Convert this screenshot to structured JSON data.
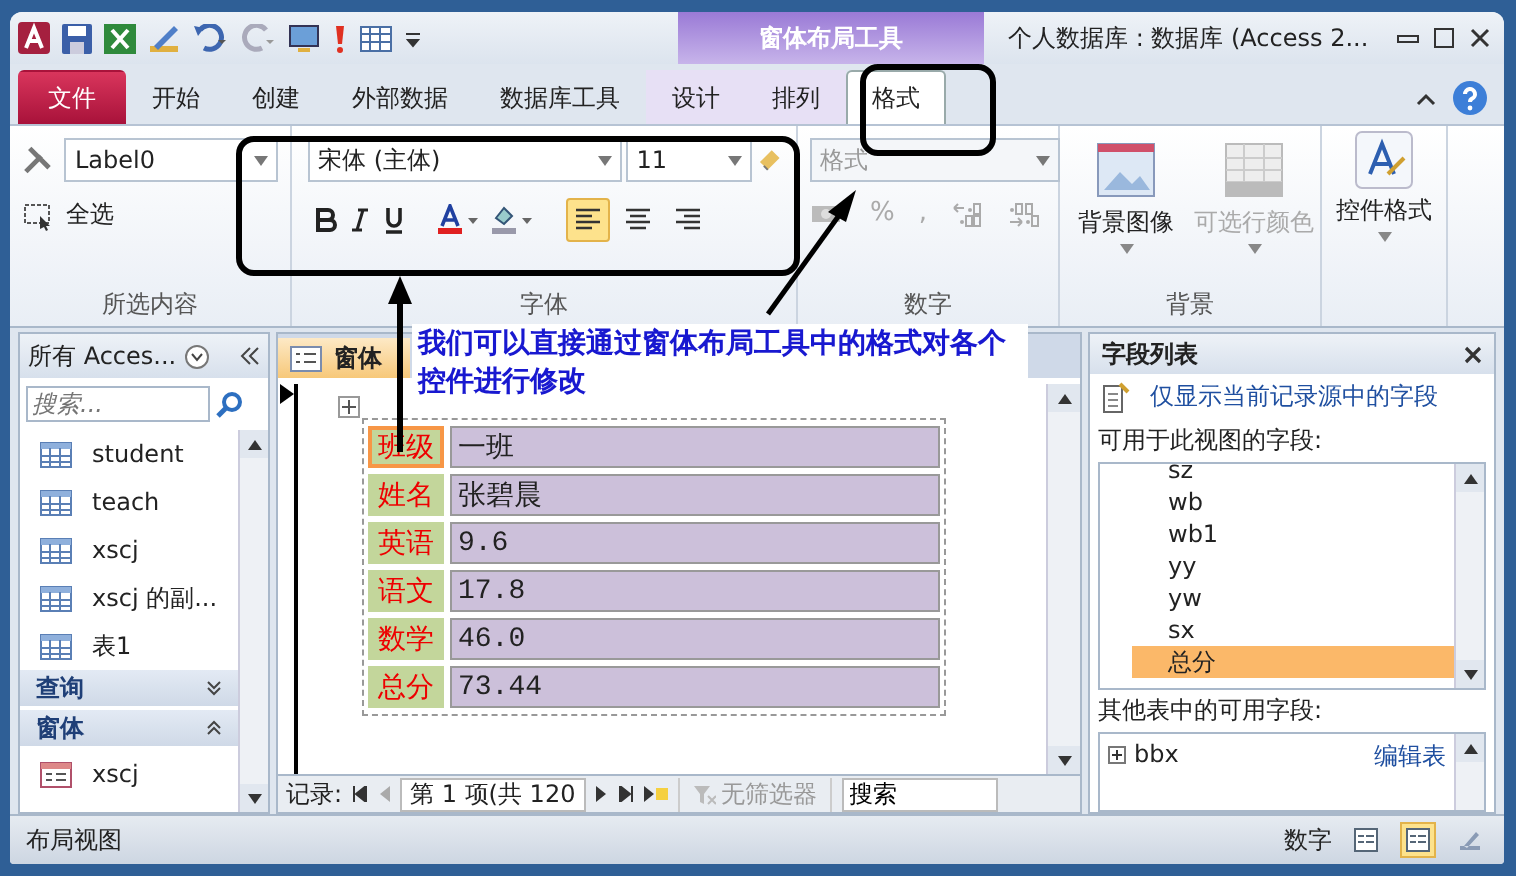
{
  "window": {
    "title": "个人数据库 : 数据库 (Access 2...",
    "contextual_group": "窗体布局工具"
  },
  "tabs": [
    {
      "label": "文件",
      "kind": "file",
      "selected": false
    },
    {
      "label": "开始",
      "kind": "tab",
      "selected": false
    },
    {
      "label": "创建",
      "kind": "tab",
      "selected": false
    },
    {
      "label": "外部数据",
      "kind": "tab",
      "selected": false
    },
    {
      "label": "数据库工具",
      "kind": "tab",
      "selected": false
    },
    {
      "label": "设计",
      "kind": "context",
      "selected": false
    },
    {
      "label": "排列",
      "kind": "context",
      "selected": false
    },
    {
      "label": "格式",
      "kind": "context",
      "selected": true
    }
  ],
  "selection_group": {
    "caption": "所选内容",
    "object": "Label0",
    "select_all": "全选"
  },
  "font_group": {
    "caption": "字体",
    "font": "宋体 (主体)",
    "size": "11",
    "alignment": [
      {
        "selected": true
      },
      {
        "selected": false
      },
      {
        "selected": false
      }
    ]
  },
  "number_group": {
    "caption": "数字",
    "format_placeholder": "格式",
    "buttons": [
      "%",
      ","
    ]
  },
  "background_group": {
    "caption": "背景",
    "buttons": [
      {
        "label": "背景图像",
        "disabled": false
      },
      {
        "label": "可选行颜色",
        "disabled": true
      }
    ]
  },
  "control_group": {
    "button": "控件格式"
  },
  "navigation": {
    "title": "所有 Acces...",
    "search_placeholder": "搜索...",
    "items": [
      {
        "kind": "table",
        "label": "student"
      },
      {
        "kind": "table",
        "label": "teach"
      },
      {
        "kind": "table",
        "label": "xscj"
      },
      {
        "kind": "table",
        "label": "xscj 的副..."
      },
      {
        "kind": "table",
        "label": "表1"
      },
      {
        "kind": "group",
        "label": "查询",
        "expanded": false
      },
      {
        "kind": "group",
        "label": "窗体",
        "expanded": true
      },
      {
        "kind": "form",
        "label": "xscj"
      }
    ]
  },
  "document": {
    "tab": "窗体",
    "fields": [
      {
        "label": "班级",
        "value": "一班",
        "selected": true
      },
      {
        "label": "姓名",
        "value": "张碧晨",
        "selected": false
      },
      {
        "label": "英语",
        "value": "9.6",
        "selected": false
      },
      {
        "label": "语文",
        "value": "17.8",
        "selected": false
      },
      {
        "label": "数学",
        "value": "46.0",
        "selected": false
      },
      {
        "label": "总分",
        "value": "73.44",
        "selected": false
      }
    ],
    "record_nav": {
      "label": "记录:",
      "position": "第 1 项(共 120",
      "filter": "无筛选器",
      "search": "搜索"
    }
  },
  "annotation": {
    "text": "我们可以直接通过窗体布局工具中的格式对各个控件进行修改"
  },
  "field_list": {
    "title": "字段列表",
    "link": "仅显示当前记录源中的字段",
    "available_label": "可用于此视图的字段:",
    "fields": [
      {
        "label": "sz",
        "selected": false
      },
      {
        "label": "wb",
        "selected": false
      },
      {
        "label": "wb1",
        "selected": false
      },
      {
        "label": "yy",
        "selected": false
      },
      {
        "label": "yw",
        "selected": false
      },
      {
        "label": "sx",
        "selected": false
      },
      {
        "label": "总分",
        "selected": true
      }
    ],
    "other_label": "其他表中的可用字段:",
    "other_tables": [
      {
        "label": "bbx",
        "action": "编辑表"
      }
    ]
  },
  "status_bar": {
    "view": "布局视图",
    "indicator": "数字",
    "view_buttons": [
      {
        "selected": false
      },
      {
        "selected": true
      },
      {
        "selected": false
      }
    ]
  }
}
